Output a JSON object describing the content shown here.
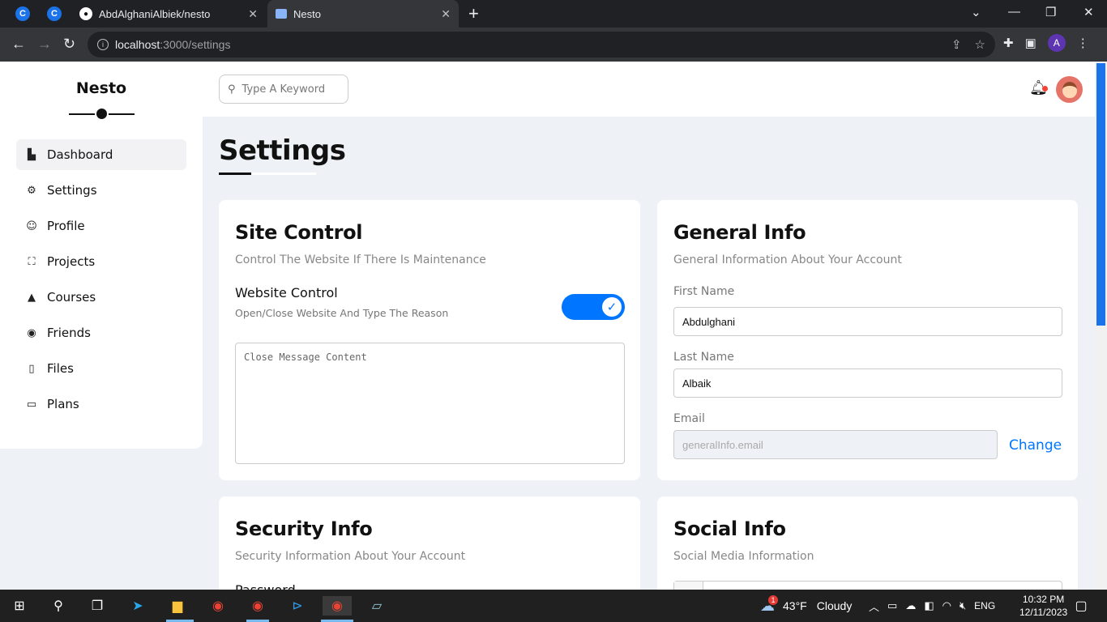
{
  "browser": {
    "tabs": [
      {
        "label": "AbdAlghaniAlbiek/nesto",
        "active": false
      },
      {
        "label": "Nesto",
        "active": true
      }
    ],
    "url_host": "localhost",
    "url_path": ":3000/settings",
    "profile_initial": "A"
  },
  "sidebar": {
    "brand": "Nesto",
    "items": [
      {
        "label": "Dashboard",
        "icon": "chart-icon",
        "active": true
      },
      {
        "label": "Settings",
        "icon": "gear-icon"
      },
      {
        "label": "Profile",
        "icon": "user-icon"
      },
      {
        "label": "Projects",
        "icon": "diagram-icon"
      },
      {
        "label": "Courses",
        "icon": "graduation-cap-icon"
      },
      {
        "label": "Friends",
        "icon": "user-circle-icon"
      },
      {
        "label": "Files",
        "icon": "file-icon"
      },
      {
        "label": "Plans",
        "icon": "credit-card-icon"
      }
    ]
  },
  "header": {
    "search_placeholder": "Type A Keyword"
  },
  "page": {
    "title": "Settings"
  },
  "site_control": {
    "title": "Site Control",
    "subtitle": "Control The Website If There Is Maintenance",
    "website_control_label": "Website Control",
    "website_control_desc": "Open/Close Website And Type The Reason",
    "toggle_on": true,
    "textarea_placeholder": "Close Message Content"
  },
  "general_info": {
    "title": "General Info",
    "subtitle": "General Information About Your Account",
    "first_name_label": "First Name",
    "first_name_value": "Abdulghani",
    "last_name_label": "Last Name",
    "last_name_value": "Albaik",
    "email_label": "Email",
    "email_value": "generalInfo.email",
    "change_label": "Change"
  },
  "security_info": {
    "title": "Security Info",
    "subtitle": "Security Information About Your Account",
    "password_label": "Password"
  },
  "social_info": {
    "title": "Social Info",
    "subtitle": "Social Media Information"
  },
  "taskbar": {
    "weather_temp": "43°F",
    "weather_desc": "Cloudy",
    "weather_badge": "1",
    "language": "ENG",
    "time": "10:32 PM",
    "date": "12/11/2023"
  },
  "colors": {
    "accent": "#0075ff",
    "page_bg": "#eef1f6",
    "chrome_dark": "#202124"
  }
}
